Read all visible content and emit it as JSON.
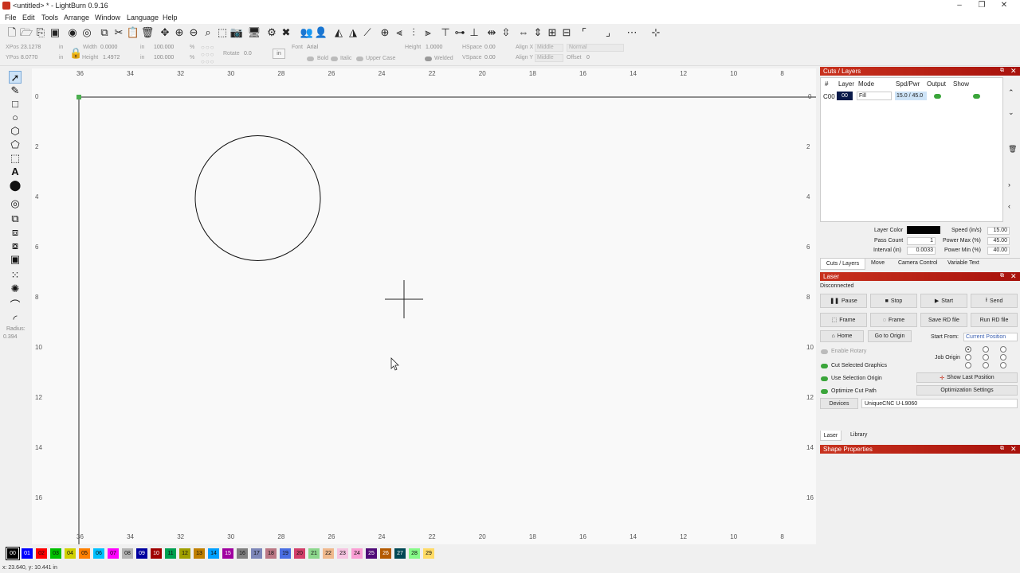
{
  "window": {
    "title": "<untitled> * - LightBurn 0.9.16"
  },
  "menu": [
    "File",
    "Edit",
    "Tools",
    "Arrange",
    "Window",
    "Language",
    "Help"
  ],
  "props": {
    "xpos_label": "XPos",
    "xpos_value": "23.1278",
    "ypos_label": "YPos",
    "ypos_value": "8.0770",
    "unit_in": "in",
    "width_label": "Width",
    "width_value": "0.0000",
    "height_label": "Height",
    "height_value": "1.4972",
    "scale_w": "100.000",
    "scale_h": "100.000",
    "percent": "%",
    "rotate_label": "Rotate",
    "rotate_value": "0.0",
    "units_btn": "in",
    "font_label": "Font",
    "font_value": "Arial",
    "text_height_label": "Height",
    "text_height_value": "1.0000",
    "hspace_label": "HSpace",
    "hspace_value": "0.00",
    "vspace_label": "VSpace",
    "vspace_value": "0.00",
    "alignx_label": "Align X",
    "alignx_value": "Middle",
    "aligny_label": "Align Y",
    "aligny_value": "Middle",
    "normal_value": "Normal",
    "offset_label": "Offset",
    "offset_value": "0",
    "bold": "Bold",
    "italic": "Italic",
    "uppercase": "Upper Case",
    "welded": "Welded"
  },
  "radius": {
    "label": "Radius:",
    "value": "0.394"
  },
  "ruler": {
    "top": [
      "36",
      "34",
      "32",
      "30",
      "28",
      "26",
      "24",
      "22",
      "20",
      "18",
      "16",
      "14",
      "12",
      "10",
      "8"
    ],
    "left": [
      "0",
      "2",
      "4",
      "6",
      "8",
      "10",
      "12",
      "14",
      "16"
    ]
  },
  "cuts_layers": {
    "title": "Cuts / Layers",
    "headers": [
      "#",
      "Layer",
      "Mode",
      "Spd/Pwr",
      "Output",
      "Show"
    ],
    "row": {
      "num": "C00",
      "layer": "00",
      "mode": "Fill",
      "spdpwr": "15.0 / 45.0"
    },
    "layer_color_label": "Layer Color",
    "pass_count_label": "Pass Count",
    "pass_count_value": "1",
    "interval_label": "Interval (in)",
    "interval_value": "0.0033",
    "speed_label": "Speed (in/s)",
    "speed_value": "15.00",
    "power_max_label": "Power Max (%)",
    "power_max_value": "45.00",
    "power_min_label": "Power Min (%)",
    "power_min_value": "40.00",
    "tabs": [
      "Cuts / Layers",
      "Move",
      "Camera Control",
      "Variable Text"
    ]
  },
  "laser": {
    "title": "Laser",
    "status": "Disconnected",
    "pause": "Pause",
    "stop": "Stop",
    "start": "Start",
    "send": "Send",
    "frame1": "Frame",
    "frame2": "Frame",
    "save_rd": "Save RD file",
    "run_rd": "Run RD file",
    "home": "Home",
    "go_origin": "Go to Origin",
    "start_from_label": "Start From:",
    "start_from_value": "Current Position",
    "enable_rotary": "Enable Rotary",
    "job_origin": "Job Origin",
    "cut_selected": "Cut Selected Graphics",
    "use_selection": "Use Selection Origin",
    "optimize": "Optimize Cut Path",
    "show_last": "Show Last Position",
    "opt_settings": "Optimization Settings",
    "devices": "Devices",
    "device_value": "UniqueCNC U-L9060",
    "tabs": [
      "Laser",
      "Library"
    ]
  },
  "shape_props": {
    "title": "Shape Properties"
  },
  "palette": [
    "00",
    "01",
    "02",
    "03",
    "04",
    "05",
    "06",
    "07",
    "08",
    "09",
    "10",
    "11",
    "12",
    "13",
    "14",
    "15",
    "16",
    "17",
    "18",
    "19",
    "20",
    "21",
    "22",
    "23",
    "24",
    "25",
    "26",
    "27",
    "28",
    "29"
  ],
  "palette_colors": [
    "#000000",
    "#0000ff",
    "#ff0000",
    "#00c000",
    "#d0d000",
    "#ff8000",
    "#00c0ff",
    "#ff00ff",
    "#b4b4b4",
    "#0000a0",
    "#a00000",
    "#00a050",
    "#a0a000",
    "#c08000",
    "#00a0ff",
    "#a000a0",
    "#808080",
    "#7d87b9",
    "#bb7784",
    "#4a6fe3",
    "#d33f6a",
    "#8cd78c",
    "#f0b98d",
    "#f6c4e1",
    "#fa9ed4",
    "#500a78",
    "#b45a00",
    "#004754",
    "#86fa88",
    "#ffdb66"
  ],
  "status": {
    "coords": "x: 23.640, y: 10.441 in"
  }
}
